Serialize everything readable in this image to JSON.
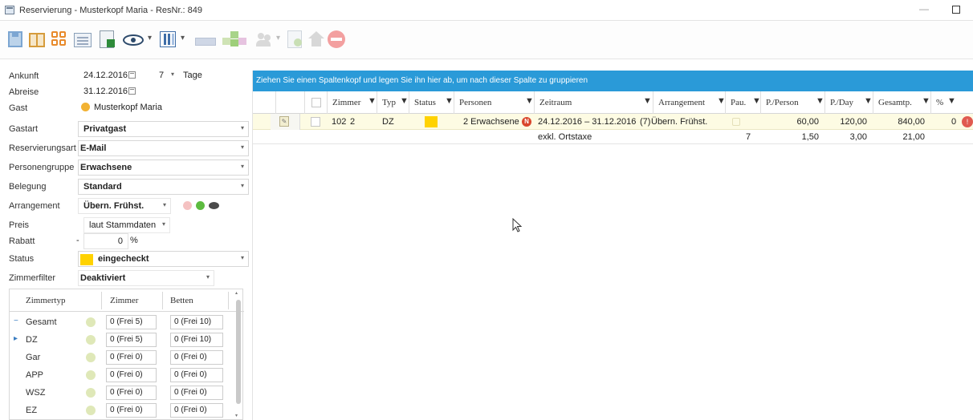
{
  "window": {
    "title": "Reservierung - Musterkopf Maria - ResNr.: 849"
  },
  "form": {
    "ankunft": {
      "label": "Ankunft",
      "date": "24.12.2016",
      "nights": "7",
      "nights_unit": "Tage"
    },
    "abreise": {
      "label": "Abreise",
      "date": "31.12.2016"
    },
    "gast": {
      "label": "Gast",
      "name": "Musterkopf Maria"
    },
    "gastart": {
      "label": "Gastart",
      "value": "Privatgast"
    },
    "reservierungsart": {
      "label": "Reservierungsart",
      "value": "E-Mail"
    },
    "personengruppe": {
      "label": "Personengruppe",
      "value": "Erwachsene"
    },
    "belegung": {
      "label": "Belegung",
      "value": "Standard"
    },
    "arrangement": {
      "label": "Arrangement",
      "value": "Übern. Frühst."
    },
    "preis": {
      "label": "Preis",
      "value": "laut Stammdaten"
    },
    "rabatt": {
      "label": "Rabatt",
      "sign": "-",
      "value": "0",
      "unit": "%"
    },
    "status": {
      "label": "Status",
      "value": "eingecheckt",
      "color": "#ffd200"
    },
    "zimmerfilter": {
      "label": "Zimmerfilter",
      "value": "Deaktiviert"
    }
  },
  "roomtypes": {
    "headers": [
      "Zimmertyp",
      "Zimmer",
      "Betten"
    ],
    "rows": [
      {
        "name": "Gesamt",
        "zimmer": "0",
        "zimmer_frei": "(Frei 5)",
        "betten": "0",
        "betten_frei": "(Frei 10)",
        "expander": "−"
      },
      {
        "name": "DZ",
        "zimmer": "0",
        "zimmer_frei": "(Frei 5)",
        "betten": "0",
        "betten_frei": "(Frei 10)",
        "expander": "▸"
      },
      {
        "name": "Gar",
        "zimmer": "0",
        "zimmer_frei": "(Frei 0)",
        "betten": "0",
        "betten_frei": "(Frei 0)",
        "expander": ""
      },
      {
        "name": "APP",
        "zimmer": "0",
        "zimmer_frei": "(Frei 0)",
        "betten": "0",
        "betten_frei": "(Frei 0)",
        "expander": ""
      },
      {
        "name": "WSZ",
        "zimmer": "0",
        "zimmer_frei": "(Frei 0)",
        "betten": "0",
        "betten_frei": "(Frei 0)",
        "expander": ""
      },
      {
        "name": "EZ",
        "zimmer": "0",
        "zimmer_frei": "(Frei 0)",
        "betten": "0",
        "betten_frei": "(Frei 0)",
        "expander": ""
      }
    ]
  },
  "grid": {
    "group_hint": "Ziehen Sie einen Spaltenkopf und legen Sie ihn hier ab, um nach dieser Spalte zu gruppieren",
    "columns": [
      "Zimmer",
      "Typ",
      "Status",
      "Personen",
      "Zeitraum",
      "Arrangement",
      "Pau.",
      "P./Person",
      "P./Day",
      "Gesamtp.",
      "%"
    ],
    "row": {
      "zimmer": "102",
      "zimmer_nr": "2",
      "typ": "DZ",
      "status_color": "#ffd200",
      "personen": "2 Erwachsene",
      "personen_badge": "N",
      "zeitraum": "24.12.2016 – 31.12.2016",
      "nights": "(7)",
      "arrangement": "Übern. Frühst.",
      "p_person": "60,00",
      "p_day": "120,00",
      "gesamt": "840,00",
      "pct": "0",
      "error_badge": "!"
    },
    "subrow": {
      "label": "exkl. Ortstaxe",
      "pau": "7",
      "p_person": "1,50",
      "p_day": "3,00",
      "gesamt": "21,00"
    }
  },
  "toolbar": {
    "icons": [
      "save-icon",
      "book-icon",
      "tiles-icon",
      "list-icon",
      "excel-export-icon",
      "eye-icon",
      "columns-icon",
      "bed-icon",
      "groups-icon",
      "people-icon",
      "document-icon",
      "house-icon",
      "cancel-icon"
    ]
  }
}
